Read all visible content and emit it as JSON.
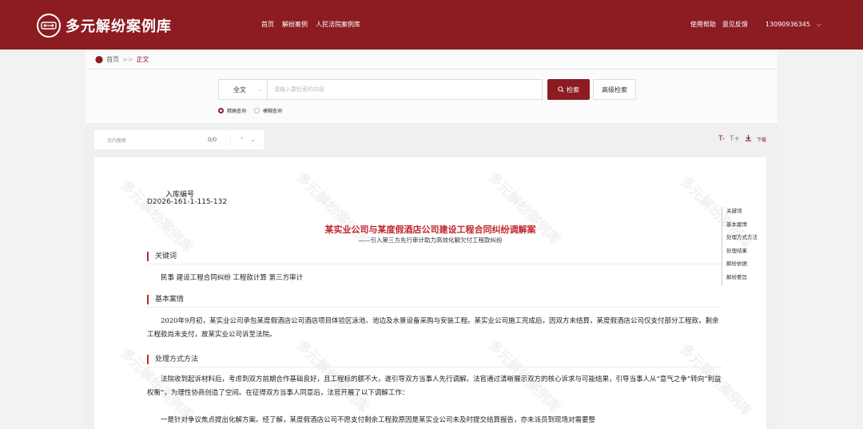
{
  "header": {
    "site_name": "多元解纷案例库",
    "nav": [
      "首页",
      "解纷案例",
      "人民法院案例库"
    ],
    "help": "使用帮助",
    "feedback": "意见反馈",
    "phone": "13090936345"
  },
  "breadcrumb": {
    "home": "首页",
    "sep": ">>",
    "current": "正文"
  },
  "search": {
    "scope": "全文",
    "placeholder": "请输入要检索的内容",
    "search_label": "检索",
    "advanced_label": "高级检索",
    "modes": [
      "精确查询",
      "模糊查询"
    ]
  },
  "find_in_page": {
    "placeholder": "页内搜索",
    "count": "0/0"
  },
  "tools": {
    "font_decrease": "T-",
    "font_increase": "T+",
    "download": "下载"
  },
  "article": {
    "watermark": "多元解纷案例库",
    "code_label": "入库编号",
    "code_value": "D2026-161-1-115-132",
    "title": "某实业公司与某度假酒店公司建设工程合同纠纷调解案",
    "subtitle": "——引入第三方先行审计助力高效化解欠付工程款纠纷",
    "sections": {
      "keywords_head": "关键词",
      "keywords": "民事  建设工程合同纠纷  工程款计算  第三方审计",
      "basic_head": "基本案情",
      "basic": "2020年9月初，某实业公司承包某度假酒店公司酒店项目体验区泳池、池边及水景设备采购与安装工程。某实业公司施工完成后，因双方未结算，某度假酒店公司仅支付部分工程款，剩余工程款尚未支付，故某实业公司诉至法院。",
      "method_head": "处理方式方法",
      "method_p1": "法院收到起诉材料后，考虑到双方前期合作基础良好，且工程标的额不大，遂引导双方当事人先行调解。法官通过清晰展示双方的核心诉求与可能结果，引导当事人从“意气之争”转向“利益权衡”，为理性协商创造了空间。在征得双方当事人同意后，法官开展了以下调解工作：",
      "method_p2": "一是针对争议焦点提出化解方案。经了解，某度假酒店公司不愿支付剩余工程款原因是某实业公司未及时提交结算报告，亦未派员到现场对需要整"
    },
    "toc": [
      "关键词",
      "基本案情",
      "处理方式方法",
      "处理结果",
      "解纷依据",
      "解纷要旨"
    ]
  }
}
